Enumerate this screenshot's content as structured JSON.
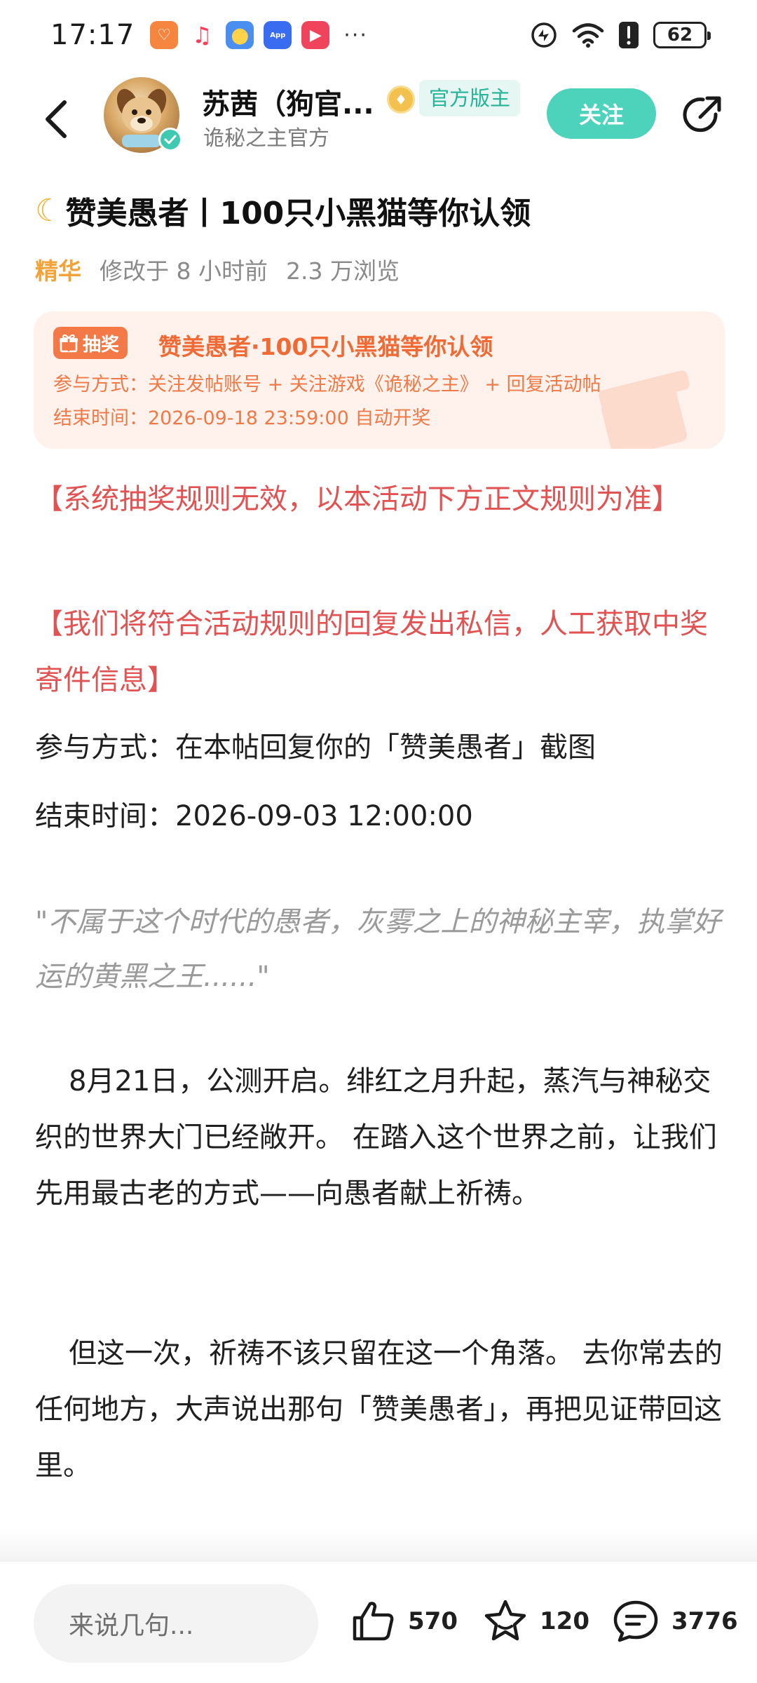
{
  "status_bar": {
    "time": "17:17",
    "battery": "62"
  },
  "header": {
    "author_name": "苏茜（狗官...",
    "author_subtitle": "诡秘之主官方",
    "role_tag": "官方版主",
    "follow_label": "关注"
  },
  "post": {
    "title": "赞美愚者丨100只小黑猫等你认领",
    "essence_tag": "精华",
    "modified": "修改于 8 小时前",
    "views": "2.3 万浏览"
  },
  "lottery": {
    "badge": "抽奖",
    "title": "赞美愚者·100只小黑猫等你认领",
    "participation": "参与方式：关注发帖账号 + 关注游戏《诡秘之主》 + 回复活动帖",
    "end_time": "结束时间：2026-09-18 23:59:00 自动开奖"
  },
  "content": {
    "red_notice_1": "【系统抽奖规则无效，以本活动下方正文规则为准】",
    "red_notice_2": "【我们将符合活动规则的回复发出私信，人工获取中奖寄件信息】",
    "participation": "参与方式：在本帖回复你的「赞美愚者」截图",
    "end_time": "结束时间：2026-09-03 12:00:00",
    "quote": "\"不属于这个时代的愚者，灰雾之上的神秘主宰，执掌好运的黄黑之王......\"",
    "paragraph_1": "8月21日，公测开启。绯红之月升起，蒸汽与神秘交织的世界大门已经敞开。 在踏入这个世界之前，让我们先用最古老的方式——向愚者献上祈祷。",
    "paragraph_2": "但这一次，祈祷不该只留在这一个角落。 去你常去的任何地方，大声说出那句「赞美愚者」，再把见证带回这里。"
  },
  "bottom_bar": {
    "comment_placeholder": "来说几句...",
    "likes": "570",
    "favorites": "120",
    "comments": "3776"
  },
  "colors": {
    "accent": "#4dd2bb",
    "red_text": "#e15252",
    "lottery_orange": "#ef6a35",
    "essence": "#f1a33a"
  },
  "icons": {
    "back": "back-arrow-icon",
    "share": "share-icon",
    "like": "thumbs-up-icon",
    "favorite": "star-icon",
    "comment": "comment-icon",
    "gift": "gift-icon"
  }
}
